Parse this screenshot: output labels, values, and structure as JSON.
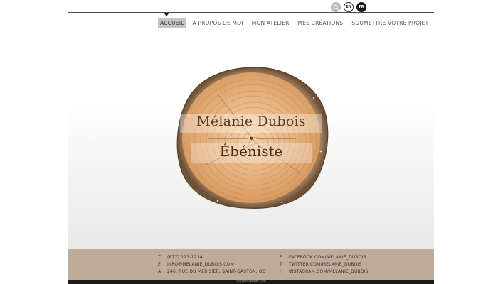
{
  "header": {
    "search_icon": "search-icon",
    "lang_en": "EN",
    "lang_fr": "FR"
  },
  "nav": {
    "items": [
      "ACCUEIL",
      "À PROPOS DE MOI",
      "MON ATELIER",
      "MES CRÉATIONS",
      "SOUMETTRE VOTRE PROJET"
    ],
    "active": "ACCUEIL"
  },
  "hero": {
    "name": "Mélanie Dubois",
    "trade": "Ébéniste"
  },
  "footer": {
    "contact": [
      {
        "label": "T",
        "value": "(877) 123-1234"
      },
      {
        "label": "E",
        "value": "INFO@MELANIE_DUBOIS.COM"
      },
      {
        "label": "A",
        "value": "246, RUE DU MERISIER, SAINT-GASTON, QC"
      }
    ],
    "social": [
      {
        "label": "F",
        "value": "FACEBOOK.COM/MELANIE_DUBOIS"
      },
      {
        "label": "T",
        "value": "TWITTER.COM/MELANIE_DUBOIS"
      },
      {
        "label": "I",
        "value": "INSTAGRAM.COM/MELANIE_DUBOIS"
      }
    ],
    "copyright": "TOUS DROITS RÉSERVÉS © 2014"
  },
  "colors": {
    "footer_bg": "#bfab9a",
    "wood_light": "#e9b98a",
    "wood_dark": "#c98a52",
    "bark": "#8a6a48"
  }
}
